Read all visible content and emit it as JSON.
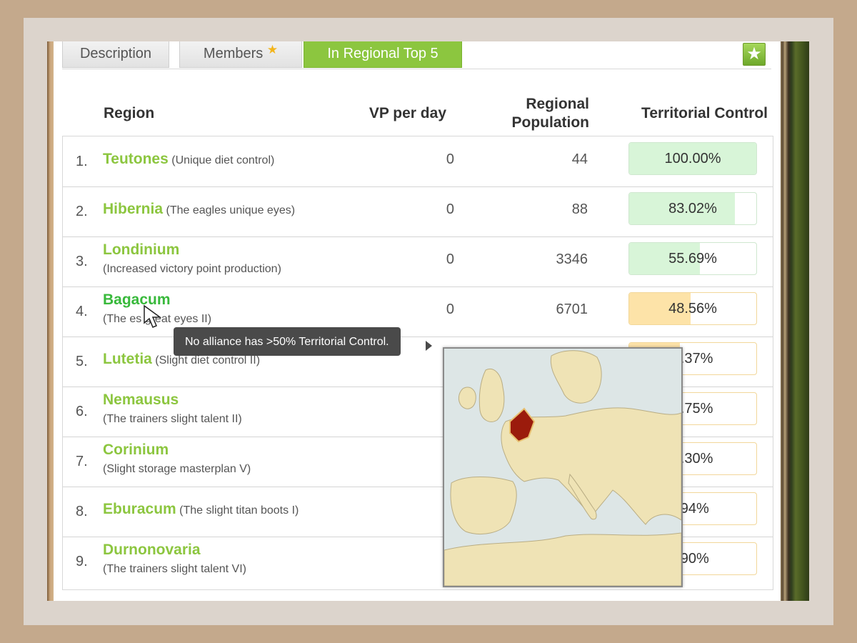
{
  "tabs": {
    "description": "Description",
    "members": "Members",
    "regional_top": "In Regional Top 5",
    "favorite_icon": "star-icon"
  },
  "headers": {
    "region": "Region",
    "vp_per_day": "VP per day",
    "regional_population": "Regional Population",
    "territorial_control": "Territorial Control"
  },
  "rows": [
    {
      "rank": "1.",
      "name": "Teutones",
      "bonus": "(Unique diet control)",
      "vp": "0",
      "population": "44",
      "control": "100.00%",
      "fill": 1.0,
      "color": "#d8f5d8"
    },
    {
      "rank": "2.",
      "name": "Hibernia",
      "bonus": "(The eagles unique eyes)",
      "vp": "0",
      "population": "88",
      "control": "83.02%",
      "fill": 0.8302,
      "color": "#d8f5d8"
    },
    {
      "rank": "3.",
      "name": "Londinium",
      "bonus": "(Increased victory point production)",
      "vp": "0",
      "population": "3346",
      "control": "55.69%",
      "fill": 0.5569,
      "color": "#d8f5d8"
    },
    {
      "rank": "4.",
      "name": "Bagacum",
      "bonus": "(The     es great eyes II)",
      "vp": "0",
      "population": "6701",
      "control": "48.56%",
      "fill": 0.4856,
      "color": "#fde3a8"
    },
    {
      "rank": "5.",
      "name": "Lutetia",
      "bonus": "(Slight diet control II)",
      "vp": "",
      "population": "",
      "control": "0.37%",
      "fill": 0.4,
      "color": "#fde3a8"
    },
    {
      "rank": "6.",
      "name": "Nemausus",
      "bonus": "(The trainers slight talent II)",
      "vp": "",
      "population": "",
      "control": "3.75%",
      "fill": 0.4,
      "color": "#fde3a8"
    },
    {
      "rank": "7.",
      "name": "Corinium",
      "bonus": "(Slight storage masterplan V)",
      "vp": "",
      "population": "",
      "control": "2.30%",
      "fill": 0.4,
      "color": "#fde3a8"
    },
    {
      "rank": "8.",
      "name": "Eburacum",
      "bonus": "(The slight titan boots I)",
      "vp": "",
      "population": "",
      "control": ".94%",
      "fill": 0.4,
      "color": "#fde3a8"
    },
    {
      "rank": "9.",
      "name": "Durnonovaria",
      "bonus": "(The trainers slight talent VI)",
      "vp": "",
      "population": "",
      "control": ".90%",
      "fill": 0.4,
      "color": "#fde3a8"
    }
  ],
  "tooltip": "No alliance has >50% Territorial Control.",
  "map": {
    "highlighted_region": "Bagacum",
    "highlight_color": "#9b1b0c"
  },
  "colors": {
    "accent": "#8cc63f",
    "link_active": "#38b93b"
  }
}
